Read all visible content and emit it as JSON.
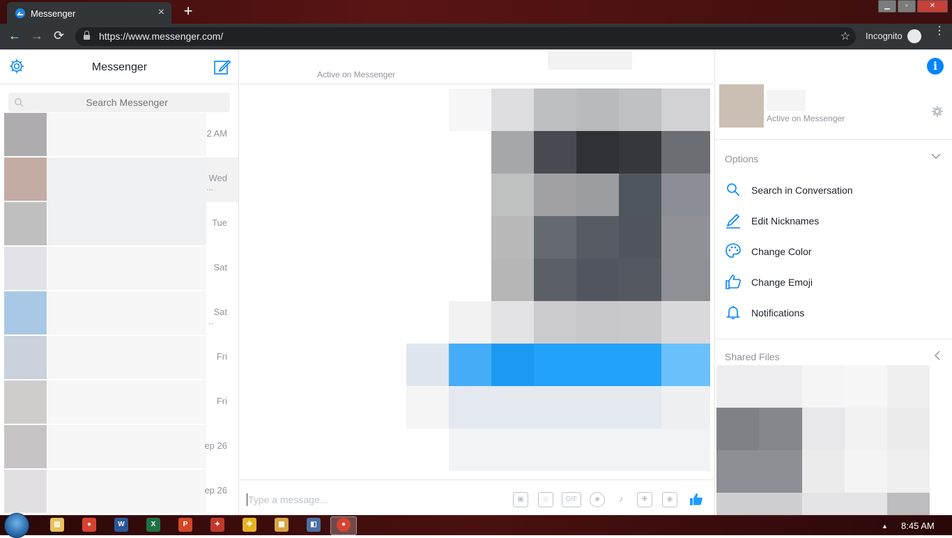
{
  "browser": {
    "tab_title": "Messenger",
    "tab_close": "×",
    "new_tab": "+",
    "url": "https://www.messenger.com/",
    "incognito_label": "Incognito",
    "bookmark_star": "☆",
    "back": "←",
    "forward": "→",
    "reload": "⟳",
    "menu": "⋮"
  },
  "window_controls": {
    "minimize": "▁",
    "maximize": "▫",
    "close": "✕"
  },
  "sidebar": {
    "title": "Messenger",
    "search_placeholder": "Search Messenger",
    "conversations": [
      {
        "time": "2 AM",
        "avatar_color": "#aeacae"
      },
      {
        "time": "Wed",
        "avatar_color": "#c3aca4",
        "more": "..."
      },
      {
        "time": "Tue",
        "avatar_color": "#c0bfbf"
      },
      {
        "time": "Sat",
        "avatar_color": "#e2e2e8"
      },
      {
        "time": "Sat",
        "avatar_color": "#a9c8e6",
        "more": ".."
      },
      {
        "time": "Fri",
        "avatar_color": "#cad2de"
      },
      {
        "time": "Fri",
        "avatar_color": "#cfcdcb"
      },
      {
        "time": "ep 26",
        "avatar_color": "#c8c3c5"
      },
      {
        "time": "ep 26",
        "avatar_color": "#e2dfe3"
      }
    ]
  },
  "chat": {
    "status": "Active on Messenger",
    "info_icon": "i",
    "composer_placeholder": "Type a message...",
    "composer_icons": [
      {
        "name": "image-icon",
        "glyph": "▣"
      },
      {
        "name": "sticker-icon",
        "glyph": "☺"
      },
      {
        "name": "gif-icon",
        "glyph": "GIF"
      },
      {
        "name": "emoji-icon",
        "glyph": "☻"
      },
      {
        "name": "microphone-icon",
        "glyph": "♪"
      },
      {
        "name": "game-icon",
        "glyph": "✚"
      },
      {
        "name": "camera-icon",
        "glyph": "◉"
      }
    ],
    "like_icon": "👍"
  },
  "details": {
    "status": "Active on Messenger",
    "options_header": "Options",
    "options": [
      {
        "label": "Search in Conversation",
        "icon": "search-icon"
      },
      {
        "label": "Edit Nicknames",
        "icon": "pencil-icon"
      },
      {
        "label": "Change Color",
        "icon": "palette-icon"
      },
      {
        "label": "Change Emoji",
        "icon": "thumbs-up-icon"
      },
      {
        "label": "Notifications",
        "icon": "bell-icon"
      }
    ],
    "shared_files_header": "Shared Files"
  },
  "taskbar": {
    "clock": "8:45 AM",
    "tray_arrow": "▲",
    "apps": [
      {
        "name": "file-explorer-icon",
        "glyph": "▤",
        "color": "#e8c25a"
      },
      {
        "name": "chrome-icon",
        "glyph": "●",
        "color": "#d8432f"
      },
      {
        "name": "word-icon",
        "glyph": "W",
        "color": "#2b5797"
      },
      {
        "name": "excel-icon",
        "glyph": "X",
        "color": "#1e7145"
      },
      {
        "name": "powerpoint-icon",
        "glyph": "P",
        "color": "#d24726"
      },
      {
        "name": "app-icon",
        "glyph": "✦",
        "color": "#c0392b"
      },
      {
        "name": "app-icon-2",
        "glyph": "✚",
        "color": "#e6b422"
      },
      {
        "name": "sticky-notes-icon",
        "glyph": "▦",
        "color": "#d9a441"
      },
      {
        "name": "app-icon-3",
        "glyph": "◧",
        "color": "#4a6fa5"
      }
    ]
  },
  "colors": {
    "accent": "#0084ff",
    "messenger_blue": "#1e9bff"
  }
}
